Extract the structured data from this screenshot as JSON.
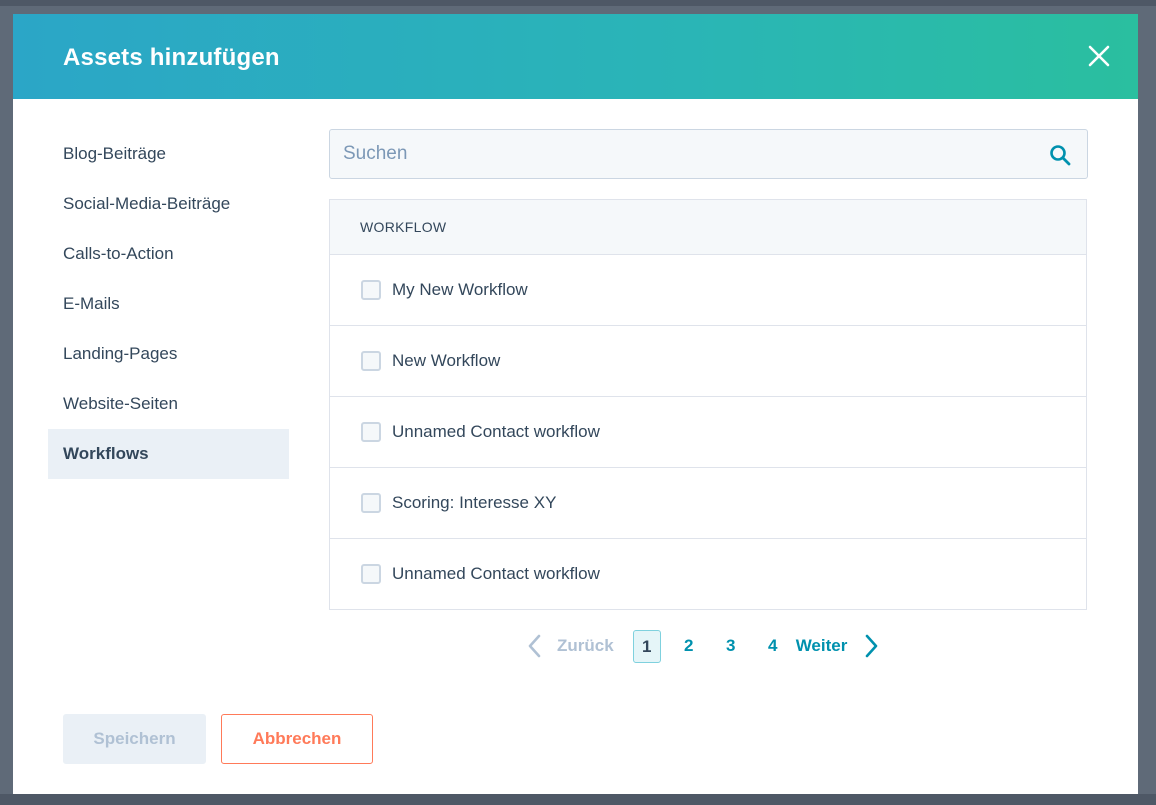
{
  "modal": {
    "title": "Assets hinzufügen"
  },
  "sidebar": {
    "items": [
      {
        "label": "Blog-Beiträge"
      },
      {
        "label": "Social-Media-Beiträge"
      },
      {
        "label": "Calls-to-Action"
      },
      {
        "label": "E-Mails"
      },
      {
        "label": "Landing-Pages"
      },
      {
        "label": "Website-Seiten"
      },
      {
        "label": "Workflows",
        "active": true
      }
    ]
  },
  "search": {
    "placeholder": "Suchen",
    "value": ""
  },
  "table": {
    "header": "WORKFLOW",
    "rows": [
      {
        "label": "My New Workflow",
        "checked": false
      },
      {
        "label": "New Workflow",
        "checked": false
      },
      {
        "label": "Unnamed Contact workflow",
        "checked": false
      },
      {
        "label": "Scoring: Interesse XY",
        "checked": false
      },
      {
        "label": "Unnamed Contact workflow",
        "checked": false
      }
    ]
  },
  "pagination": {
    "prev_label": "Zurück",
    "next_label": "Weiter",
    "pages": [
      "1",
      "2",
      "3",
      "4"
    ],
    "current": "1"
  },
  "footer": {
    "save_label": "Speichern",
    "cancel_label": "Abbrechen"
  },
  "colors": {
    "accent": "#0091ae",
    "cancel": "#ff7a59",
    "text": "#33475b",
    "header_gradient_start": "#2ba6c7",
    "header_gradient_end": "#2abf9f"
  },
  "icons": {
    "close": "close-icon",
    "search": "search-icon",
    "prev": "chevron-left-icon",
    "next": "chevron-right-icon"
  }
}
